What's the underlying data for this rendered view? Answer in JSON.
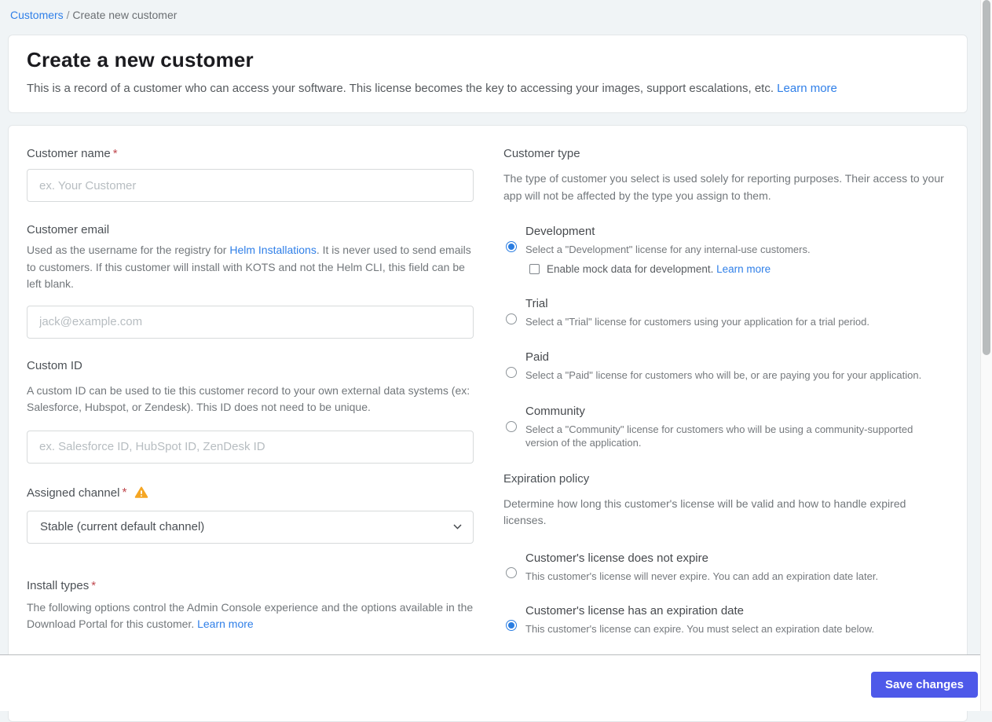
{
  "breadcrumb": {
    "link": "Customers",
    "separator": " / ",
    "current": "Create new customer"
  },
  "header": {
    "title": "Create a new customer",
    "description": "This is a record of a customer who can access your software. This license becomes the key to accessing your images, support escalations, etc. ",
    "learn_more": "Learn more"
  },
  "form": {
    "customer_name": {
      "label": "Customer name",
      "required_mark": "*",
      "placeholder": "ex. Your Customer"
    },
    "customer_email": {
      "label": "Customer email",
      "desc_before_link": "Used as the username for the registry for ",
      "link": "Helm Installations",
      "desc_after_link": ". It is never used to send emails to customers. If this customer will install with KOTS and not the Helm CLI, this field can be left blank.",
      "placeholder": "jack@example.com"
    },
    "custom_id": {
      "label": "Custom ID",
      "description": "A custom ID can be used to tie this customer record to your own external data systems (ex: Salesforce, Hubspot, or Zendesk). This ID does not need to be unique.",
      "placeholder": "ex. Salesforce ID, HubSpot ID, ZenDesk ID"
    },
    "assigned_channel": {
      "label": "Assigned channel",
      "required_mark": "*",
      "selected_option": "Stable (current default channel)"
    },
    "install_types": {
      "label": "Install types",
      "required_mark": "*",
      "description": "The following options control the Admin Console experience and the options available in the Download Portal for this customer. ",
      "learn_more": "Learn more"
    }
  },
  "customer_type": {
    "heading": "Customer type",
    "description": "The type of customer you select is used solely for reporting purposes. Their access to your app will not be affected by the type you assign to them.",
    "options": [
      {
        "title": "Development",
        "description": "Select a \"Development\" license for any internal-use customers.",
        "selected": true,
        "checkbox_label": "Enable mock data for development. ",
        "checkbox_link": "Learn more",
        "checkbox_checked": false
      },
      {
        "title": "Trial",
        "description": "Select a \"Trial\" license for customers using your application for a trial period.",
        "selected": false
      },
      {
        "title": "Paid",
        "description": "Select a \"Paid\" license for customers who will be, or are paying you for your application.",
        "selected": false
      },
      {
        "title": "Community",
        "description": "Select a \"Community\" license for customers who will be using a community-supported version of the application.",
        "selected": false
      }
    ]
  },
  "expiration_policy": {
    "heading": "Expiration policy",
    "description": "Determine how long this customer's license will be valid and how to handle expired licenses.",
    "options": [
      {
        "title": "Customer's license does not expire",
        "description": "This customer's license will never expire. You can add an expiration date later.",
        "selected": false
      },
      {
        "title": "Customer's license has an expiration date",
        "description": "This customer's license can expire. You must select an expiration date below.",
        "selected": true
      }
    ]
  },
  "footer": {
    "save_button": "Save changes"
  },
  "colors": {
    "accent_blue": "#2f7fe8",
    "radio_blue": "#2a7de1",
    "button_indigo": "#4e59e9",
    "warning_amber": "#f5a623",
    "required_red": "#c0494f",
    "page_background": "#f0f4f6"
  }
}
